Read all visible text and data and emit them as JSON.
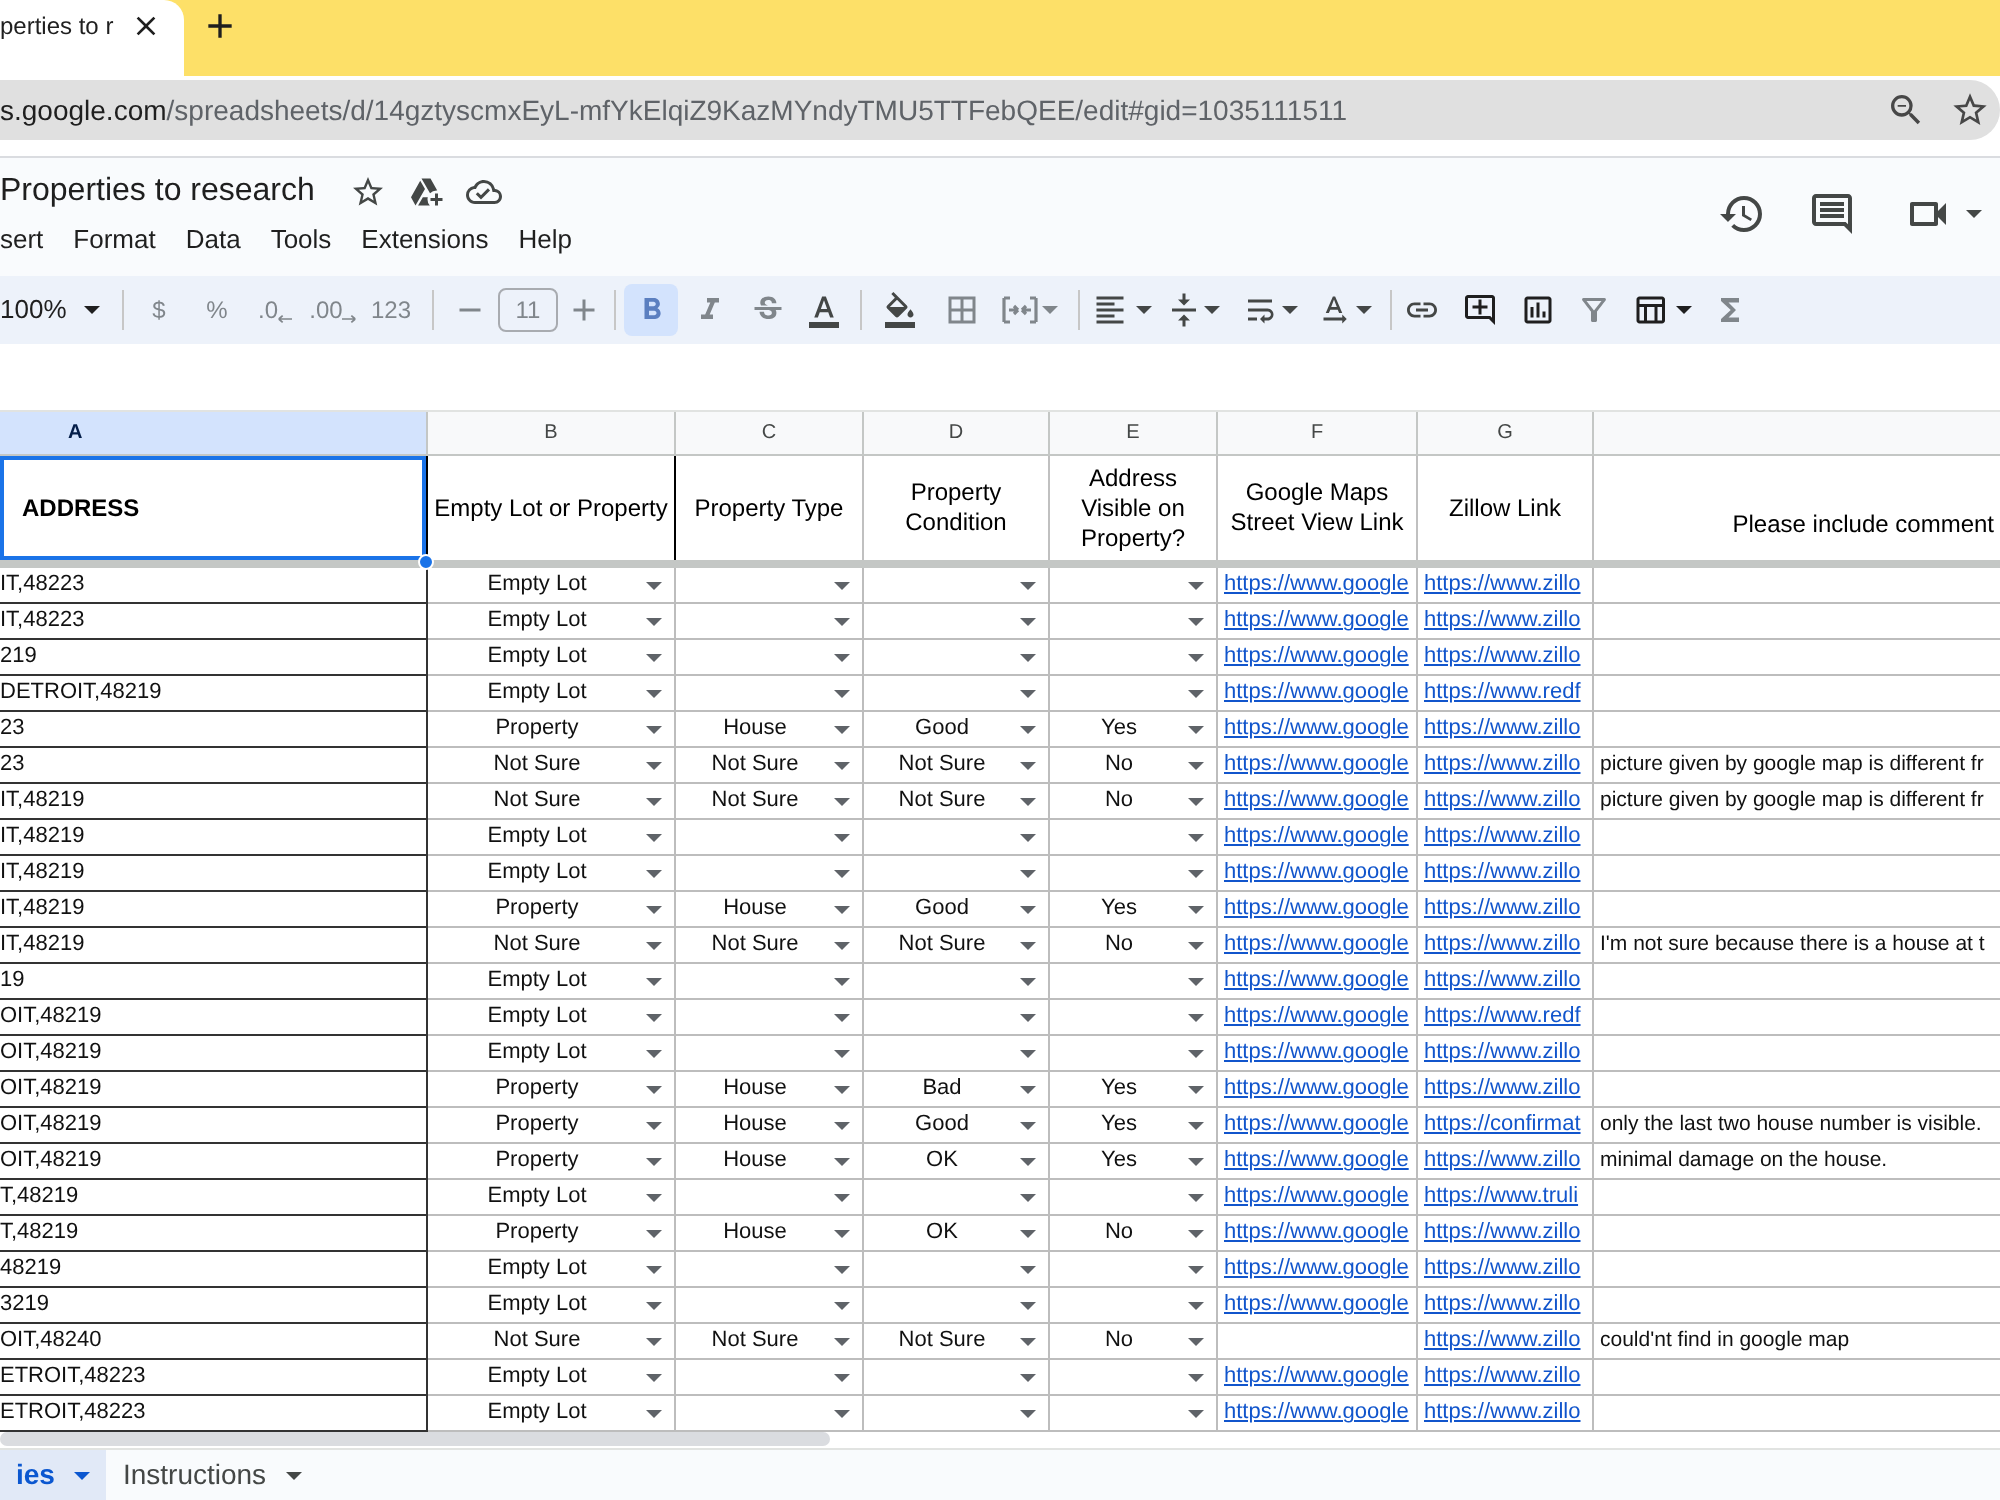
{
  "browser": {
    "tab": {
      "title": "perties to r"
    },
    "address_bar": {
      "host": "s.google.com",
      "path": "/spreadsheets/d/14gztyscmxEyL-mfYkElqiZ9KazMYndyTMU5TTFebQEE/edit#gid=1035111511"
    }
  },
  "document": {
    "title": "Properties to research"
  },
  "menu": [
    "sert",
    "Format",
    "Data",
    "Tools",
    "Extensions",
    "Help"
  ],
  "toolbar": {
    "zoom": "100%",
    "number_formats": [
      {
        "kind": "currency",
        "label": "$"
      },
      {
        "kind": "percent",
        "label": "%"
      },
      {
        "kind": "decrease",
        "label": ".0"
      },
      {
        "kind": "increase",
        "label": ".00"
      },
      {
        "kind": "number",
        "label": "123"
      }
    ],
    "font_size": "11",
    "format_buttons": [
      {
        "kind": "bold",
        "on": true
      },
      {
        "kind": "italic",
        "on": false
      },
      {
        "kind": "strikethrough",
        "on": false
      }
    ]
  },
  "sheet": {
    "columns": [
      {
        "letter": "A",
        "selected": true
      },
      {
        "letter": "B",
        "selected": false
      },
      {
        "letter": "C",
        "selected": false
      },
      {
        "letter": "D",
        "selected": false
      },
      {
        "letter": "E",
        "selected": false
      },
      {
        "letter": "F",
        "selected": false
      },
      {
        "letter": "G",
        "selected": false
      }
    ],
    "header_row": [
      "ADDRESS",
      "Empty Lot or Property",
      "Property Type",
      "Property Condition",
      "Address Visible on Property?",
      "Google Maps Street View Link",
      "Zillow Link",
      "Please include comment"
    ],
    "rows": [
      {
        "address": "IT,48223",
        "lot_or_property": "Empty Lot",
        "street_view_link": "https://www.google",
        "zillow_link": "https://www.zillo"
      },
      {
        "address": "IT,48223",
        "lot_or_property": "Empty Lot",
        "street_view_link": "https://www.google",
        "zillow_link": "https://www.zillo"
      },
      {
        "address": "219",
        "lot_or_property": "Empty Lot",
        "street_view_link": "https://www.google",
        "zillow_link": "https://www.zillo"
      },
      {
        "address": "DETROIT,48219",
        "lot_or_property": "Empty Lot",
        "street_view_link": "https://www.google",
        "zillow_link": "https://www.redf"
      },
      {
        "address": "23",
        "lot_or_property": "Property",
        "property_type": "House",
        "condition": "Good",
        "address_visible": "Yes",
        "street_view_link": "https://www.google",
        "zillow_link": "https://www.zillo"
      },
      {
        "address": "23",
        "lot_or_property": "Not Sure",
        "property_type": "Not Sure",
        "condition": "Not Sure",
        "address_visible": "No",
        "street_view_link": "https://www.google",
        "zillow_link": "https://www.zillo",
        "comment": "picture given by google map is different fr"
      },
      {
        "address": "IT,48219",
        "lot_or_property": "Not Sure",
        "property_type": "Not Sure",
        "condition": "Not Sure",
        "address_visible": "No",
        "street_view_link": "https://www.google",
        "zillow_link": "https://www.zillo",
        "comment": "picture given by google map is different fr"
      },
      {
        "address": "IT,48219",
        "lot_or_property": "Empty Lot",
        "street_view_link": "https://www.google",
        "zillow_link": "https://www.zillo"
      },
      {
        "address": "IT,48219",
        "lot_or_property": "Empty Lot",
        "street_view_link": "https://www.google",
        "zillow_link": "https://www.zillo"
      },
      {
        "address": "IT,48219",
        "lot_or_property": "Property",
        "property_type": "House",
        "condition": "Good",
        "address_visible": "Yes",
        "street_view_link": "https://www.google",
        "zillow_link": "https://www.zillo"
      },
      {
        "address": "IT,48219",
        "lot_or_property": "Not Sure",
        "property_type": "Not Sure",
        "condition": "Not Sure",
        "address_visible": "No",
        "street_view_link": "https://www.google",
        "zillow_link": "https://www.zillo",
        "comment": "I'm not sure because there is a house at t"
      },
      {
        "address": "19",
        "lot_or_property": "Empty Lot",
        "street_view_link": "https://www.google",
        "zillow_link": "https://www.zillo"
      },
      {
        "address": "OIT,48219",
        "lot_or_property": "Empty Lot",
        "street_view_link": "https://www.google",
        "zillow_link": "https://www.redf"
      },
      {
        "address": "OIT,48219",
        "lot_or_property": "Empty Lot",
        "street_view_link": "https://www.google",
        "zillow_link": "https://www.zillo"
      },
      {
        "address": "OIT,48219",
        "lot_or_property": "Property",
        "property_type": "House",
        "condition": "Bad",
        "address_visible": "Yes",
        "street_view_link": "https://www.google",
        "zillow_link": "https://www.zillo"
      },
      {
        "address": "OIT,48219",
        "lot_or_property": "Property",
        "property_type": "House",
        "condition": "Good",
        "address_visible": "Yes",
        "street_view_link": "https://www.google",
        "zillow_link": "https://confirmat",
        "comment": "only the last two house number is visible."
      },
      {
        "address": "OIT,48219",
        "lot_or_property": "Property",
        "property_type": "House",
        "condition": "OK",
        "address_visible": "Yes",
        "street_view_link": "https://www.google",
        "zillow_link": "https://www.zillo",
        "comment": "minimal damage on the house."
      },
      {
        "address": "T,48219",
        "lot_or_property": "Empty Lot",
        "street_view_link": "https://www.google",
        "zillow_link": "https://www.truli"
      },
      {
        "address": "T,48219",
        "lot_or_property": "Property",
        "property_type": "House",
        "condition": "OK",
        "address_visible": "No",
        "street_view_link": "https://www.google",
        "zillow_link": "https://www.zillo"
      },
      {
        "address": "48219",
        "lot_or_property": "Empty Lot",
        "street_view_link": "https://www.google",
        "zillow_link": "https://www.zillo"
      },
      {
        "address": "3219",
        "lot_or_property": "Empty Lot",
        "street_view_link": "https://www.google",
        "zillow_link": "https://www.zillo"
      },
      {
        "address": "OIT,48240",
        "lot_or_property": "Not Sure",
        "property_type": "Not Sure",
        "condition": "Not Sure",
        "address_visible": "No",
        "zillow_link": "https://www.zillo",
        "comment": "could'nt find in google map"
      },
      {
        "address": "ETROIT,48223",
        "lot_or_property": "Empty Lot",
        "street_view_link": "https://www.google",
        "zillow_link": "https://www.zillo"
      },
      {
        "address": "ETROIT,48223",
        "lot_or_property": "Empty Lot",
        "street_view_link": "https://www.google",
        "zillow_link": "https://www.zillo"
      }
    ]
  },
  "sheet_tabs": [
    {
      "label": "ies",
      "selected": true
    },
    {
      "label": "Instructions",
      "selected": false
    }
  ]
}
